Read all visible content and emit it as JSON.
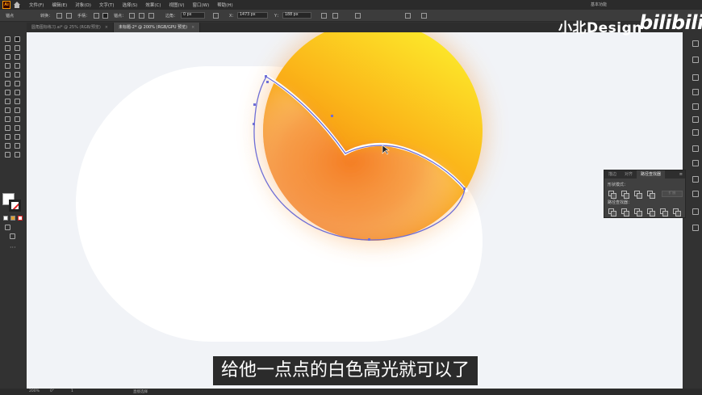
{
  "menubar": {
    "app_logo": "Ai",
    "items": [
      "文件(F)",
      "编辑(E)",
      "对象(O)",
      "文字(T)",
      "选择(S)",
      "效果(C)",
      "视图(V)",
      "窗口(W)",
      "帮助(H)"
    ],
    "workspace": "基本功能"
  },
  "controlbar": {
    "selection_label": "锚点",
    "convert_label": "转换：",
    "handles_label": "手柄：",
    "anchors_label": "锚点：",
    "corner_label": "边角：",
    "corner_value": "0 px",
    "x_label": "X：",
    "x_value": "1473 px",
    "y_label": "Y：",
    "y_value": "188 px"
  },
  "tabs": [
    {
      "label": "圆角图标练习.ai* @ 25% (RGB/预览)",
      "active": false
    },
    {
      "label": "未标题-2* @ 200% (RGB/GPU 预览)",
      "active": true
    }
  ],
  "pathfinder": {
    "tabs": [
      "描边",
      "对齐",
      "路径查找器"
    ],
    "active_tab": "路径查找器",
    "shape_modes_label": "形状模式：",
    "expand_label": "扩展",
    "pathfinders_label": "路径查找器："
  },
  "statusbar": {
    "zoom": "200%",
    "rotation": "0°",
    "artboard": "1",
    "tool": "直接选择"
  },
  "watermark": {
    "text": "小北Design",
    "logo": "bilibili"
  },
  "subtitle": "给他一点点的白色高光就可以了",
  "colors": {
    "canvas": "#f1f3f7",
    "sun_top": "#fbe02a",
    "sun_bottom": "#f27a0c",
    "path_selection": "#6f6fd6",
    "cloud": "#ffffff"
  }
}
